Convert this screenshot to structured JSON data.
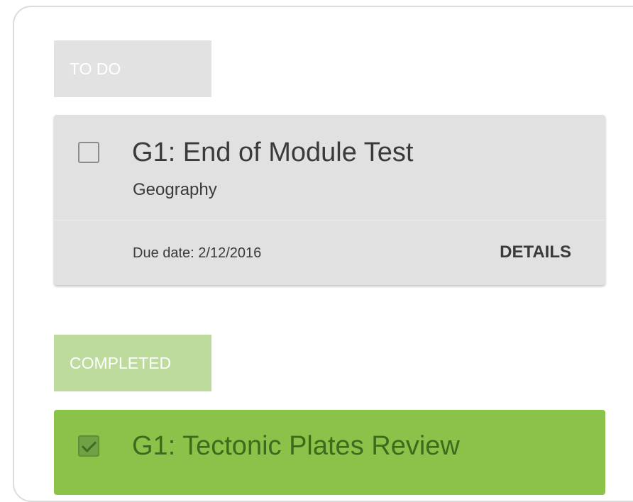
{
  "sections": {
    "todo": {
      "label": "TO DO",
      "tasks": [
        {
          "title": "G1: End of Module Test",
          "subject": "Geography",
          "due_date": "Due date: 2/12/2016",
          "details_label": "DETAILS",
          "checked": false
        }
      ]
    },
    "completed": {
      "label": "COMPLETED",
      "tasks": [
        {
          "title": "G1: Tectonic Plates Review",
          "checked": true
        }
      ]
    }
  },
  "colors": {
    "todo_label_bg": "#e2e2e2",
    "todo_card_bg": "#e1e1e1",
    "completed_label_bg": "#bddb9d",
    "completed_card_bg": "#8bc34a",
    "text": "#3a3a3a"
  },
  "icons": {
    "todo_checkbox": "unchecked-checkbox-icon",
    "completed_checkbox": "checked-checkbox-icon"
  }
}
